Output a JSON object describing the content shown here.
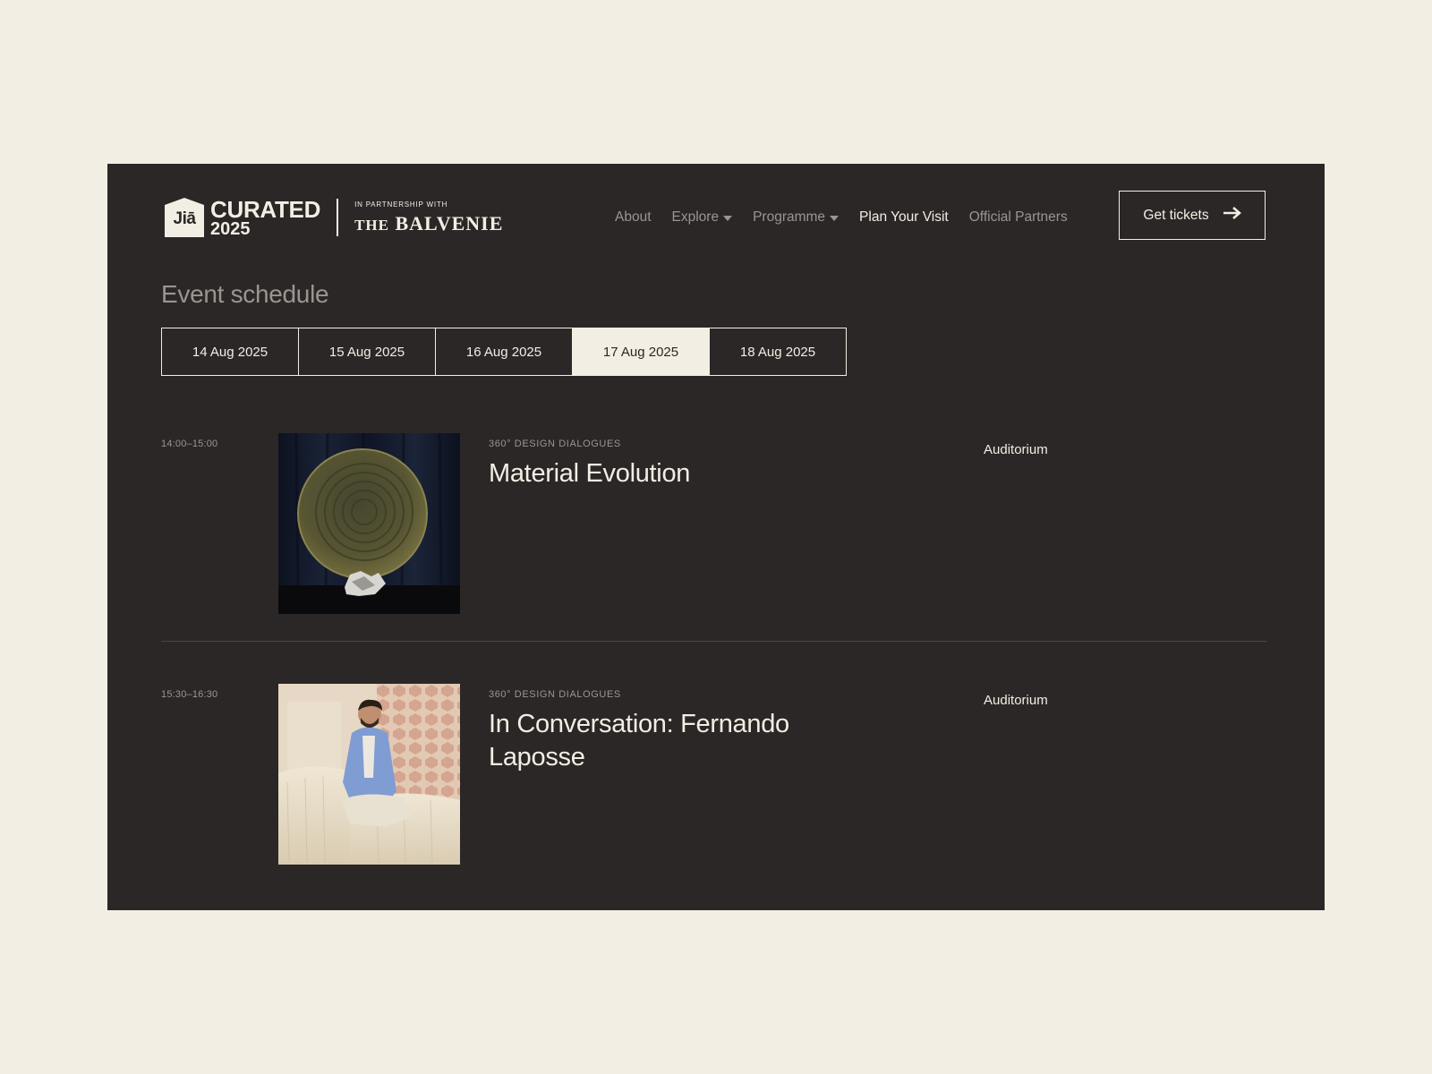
{
  "header": {
    "logo": {
      "badge_text": "Jiā",
      "brand_line1": "CURATED",
      "brand_line2": "2025",
      "partner_label": "IN PARTNERSHIP WITH",
      "partner_name_prefix": "THE",
      "partner_name": "BALVENIE"
    },
    "nav": [
      {
        "label": "About"
      },
      {
        "label": "Explore",
        "has_dropdown": true
      },
      {
        "label": "Programme",
        "has_dropdown": true
      },
      {
        "label": "Plan Your Visit",
        "active": true
      },
      {
        "label": "Official Partners"
      }
    ],
    "cta_label": "Get tickets",
    "cta_icon": "arrow-right-icon"
  },
  "schedule": {
    "title": "Event schedule",
    "dates": [
      {
        "label": "14 Aug 2025"
      },
      {
        "label": "15 Aug 2025"
      },
      {
        "label": "16 Aug 2025"
      },
      {
        "label": "17 Aug 2025",
        "selected": true
      },
      {
        "label": "18 Aug 2025"
      }
    ],
    "events": [
      {
        "time": "14:00–15:00",
        "category": "360° DESIGN DIALOGUES",
        "title": "Material Evolution",
        "venue": "Auditorium"
      },
      {
        "time": "15:30–16:30",
        "category": "360° DESIGN DIALOGUES",
        "title": "In Conversation: Fernando Laposse",
        "venue": "Auditorium"
      }
    ]
  },
  "colors": {
    "page_background": "#f2eee3",
    "panel_background": "#2b2727",
    "text_light": "#f2eee3",
    "text_muted": "#9b9590"
  }
}
